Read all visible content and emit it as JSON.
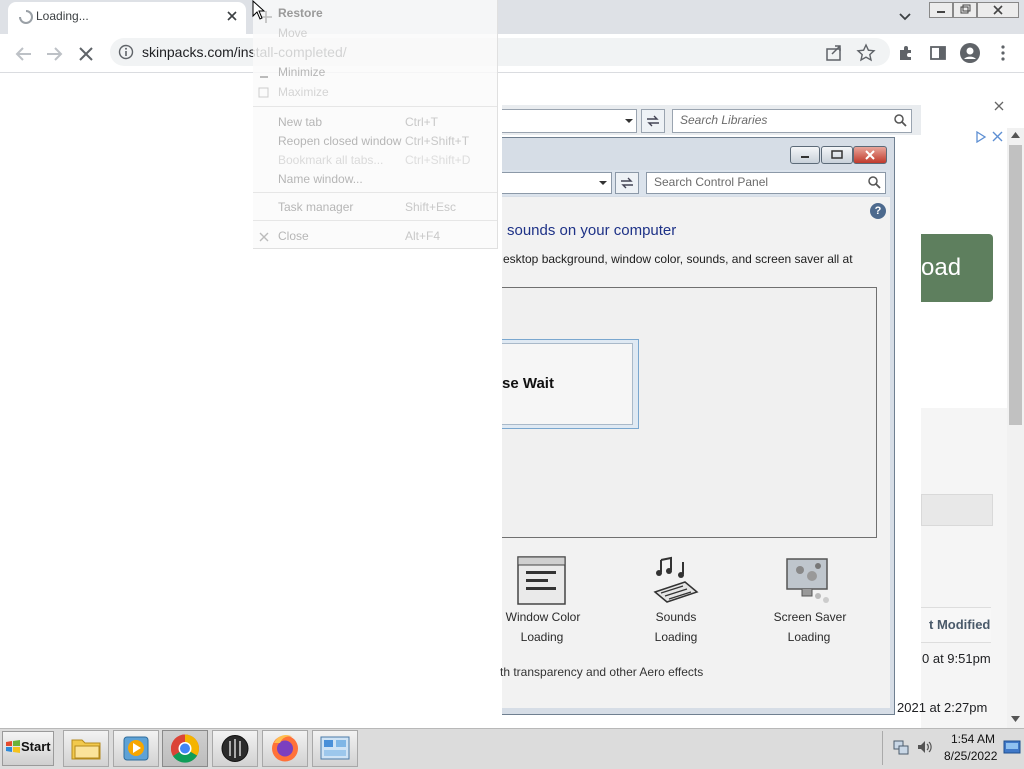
{
  "browser": {
    "tab_title": "Loading...",
    "url": "skinpacks.com/install-completed/"
  },
  "context_menu": {
    "items": [
      {
        "label": "Restore",
        "shortcut": ""
      },
      {
        "label": "Move",
        "shortcut": ""
      },
      {
        "label": "Minimize",
        "shortcut": ""
      },
      {
        "label": "Maximize",
        "shortcut": ""
      },
      {
        "label": "New tab",
        "shortcut": "Ctrl+T"
      },
      {
        "label": "Reopen closed window",
        "shortcut": "Ctrl+Shift+T"
      },
      {
        "label": "Bookmark all tabs...",
        "shortcut": "Ctrl+Shift+D"
      },
      {
        "label": "Name window...",
        "shortcut": ""
      },
      {
        "label": "Task manager",
        "shortcut": "Shift+Esc"
      },
      {
        "label": "Close",
        "shortcut": "Alt+F4"
      }
    ]
  },
  "library_window": {
    "search_placeholder": "Search Libraries"
  },
  "control_panel": {
    "search_placeholder": "Search Control Panel",
    "heading": "sounds on your computer",
    "description": "esktop background, window color, sounds, and screen saver all at",
    "wait_text": "se Wait",
    "footer": "th transparency and other Aero effects",
    "items": [
      {
        "label": "Window Color",
        "status": "Loading",
        "icon": "window-color-icon"
      },
      {
        "label": "Sounds",
        "status": "Loading",
        "icon": "sounds-icon"
      },
      {
        "label": "Screen Saver",
        "status": "Loading",
        "icon": "screen-saver-icon"
      }
    ]
  },
  "webpage": {
    "download_fragment": "oad",
    "column_header": "t Modified",
    "row1_date": "0 at 9:51pm",
    "row2_date": "2021 at 2:27pm"
  },
  "taskbar": {
    "start_label": "Start",
    "apps": [
      "file-explorer-icon",
      "media-player-icon",
      "chrome-icon",
      "app-dark-icon",
      "firefox-icon",
      "control-panel-icon"
    ],
    "time": "1:54 AM",
    "date": "8/25/2022"
  }
}
